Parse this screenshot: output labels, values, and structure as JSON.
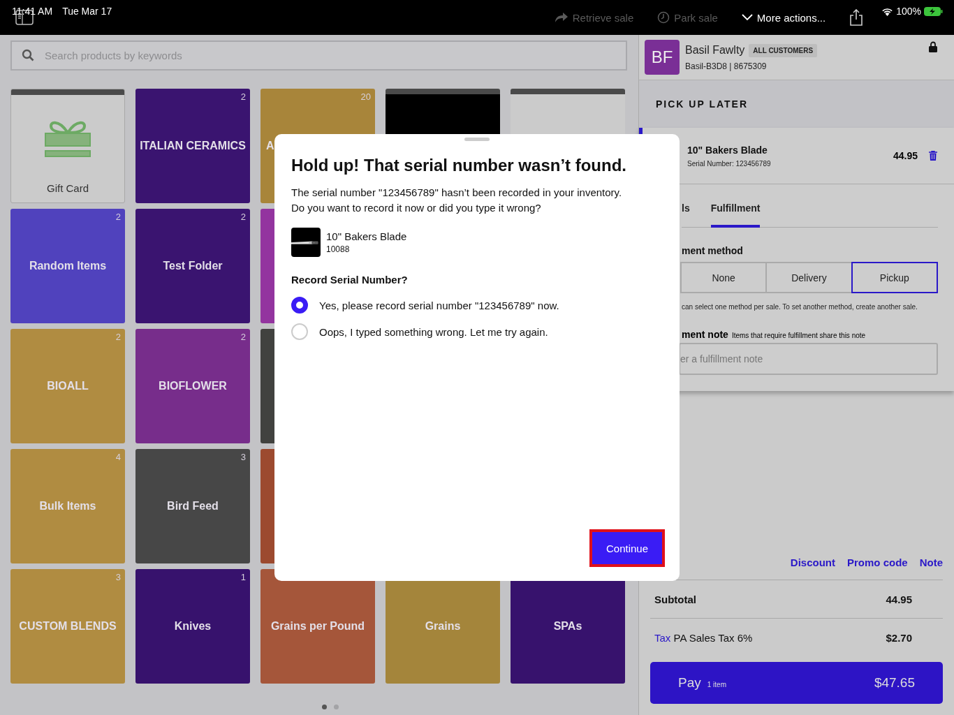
{
  "status_bar": {
    "time": "11:41 AM",
    "date": "Tue Mar 17",
    "battery": "100%"
  },
  "toolbar": [
    {
      "label": "Retrieve sale",
      "kind": "retrieve",
      "disabled": true
    },
    {
      "label": "Park sale",
      "kind": "park",
      "disabled": true
    },
    {
      "label": "More actions...",
      "kind": "more",
      "disabled": false
    }
  ],
  "search": {
    "placeholder": "Search products by keywords"
  },
  "tile_rows": [
    [
      {
        "kind": "gift",
        "label": "Gift Card"
      },
      {
        "kind": "folder",
        "label": "ITALIAN CERAMICS",
        "count": "2",
        "color": "#3a1470"
      },
      {
        "kind": "folder",
        "label": "A",
        "count": "20",
        "color": "#a8853a",
        "clipped": true
      },
      {
        "kind": "picture"
      },
      {
        "kind": "blank"
      }
    ],
    [
      {
        "kind": "folder",
        "label": "Random Items",
        "count": "2",
        "color": "#5042bd"
      },
      {
        "kind": "folder",
        "label": "Test Folder",
        "count": "2",
        "color": "#3a1470"
      },
      {
        "kind": "folder",
        "color": "#93349f"
      }
    ],
    [
      {
        "kind": "folder",
        "label": "BIOALL",
        "count": "2",
        "color": "#b08c41"
      },
      {
        "kind": "folder",
        "label": "BIOFLOWER",
        "count": "2",
        "color": "#772d8b"
      },
      {
        "kind": "folder",
        "color": "#41423f"
      }
    ],
    [
      {
        "kind": "folder",
        "label": "Bulk Items",
        "count": "4",
        "color": "#b08c41"
      },
      {
        "kind": "folder",
        "label": "Bird Feed",
        "count": "3",
        "color": "#474747"
      },
      {
        "kind": "folder",
        "color": "#9c4a2f"
      }
    ],
    [
      {
        "kind": "folder",
        "label": "CUSTOM BLENDS",
        "count": "3",
        "color": "#b08c41"
      },
      {
        "kind": "folder",
        "label": "Knives",
        "count": "1",
        "color": "#37126d"
      },
      {
        "kind": "folder",
        "label": "Grains per Pound",
        "color": "#a5563a"
      },
      {
        "kind": "folder",
        "label": "Grains",
        "color": "#a4853b"
      },
      {
        "kind": "folder",
        "label": "SPAs",
        "color": "#37126d"
      }
    ]
  ],
  "pages": [
    {
      "selected": true
    },
    {
      "selected": false
    }
  ],
  "customer": {
    "initials": "BF",
    "name": "Basil Fawlty",
    "badge": "ALL CUSTOMERS",
    "details": "Basil-B3D8 | 8675309"
  },
  "sale_type": "PICK UP LATER",
  "line_item": {
    "name": "10\" Bakers Blade",
    "serial": "Serial Number: 123456789",
    "price": "44.95"
  },
  "detail_tabs": [
    {
      "label": "ls",
      "selected": false
    },
    {
      "label": "Fulfillment",
      "selected": true
    }
  ],
  "fulfillment": {
    "method_label": "ment method",
    "methods": [
      {
        "label": "None",
        "selected": false
      },
      {
        "label": "Delivery",
        "selected": false
      },
      {
        "label": "Pickup",
        "selected": true
      }
    ],
    "hint": "can select one method per sale. To set another method, create another sale.",
    "note_label": "ment note",
    "note_hint": "Items that require fulfillment share this note",
    "note_placeholder": "er a fulfillment note"
  },
  "cart_links": [
    "Discount",
    "Promo code",
    "Note"
  ],
  "totals": [
    {
      "kind": "subtotal",
      "label": "Subtotal",
      "value": "44.95"
    },
    {
      "kind": "tax",
      "link": "Tax",
      "label": "PA Sales Tax 6%",
      "value": "$2.70"
    }
  ],
  "pay": {
    "label": "Pay",
    "count": "1 item",
    "amount": "$47.65"
  },
  "dialog": {
    "title": "Hold up! That serial number wasn’t found.",
    "message": [
      "The serial number \"123456789\" hasn’t been recorded in your inventory.",
      "Do you want to record it now or did you type it wrong?"
    ],
    "product": {
      "name": "10\" Bakers Blade",
      "sku": "10088"
    },
    "question": "Record Serial Number?",
    "options": [
      {
        "label": "Yes, please record serial number \"123456789\" now.",
        "selected": true
      },
      {
        "label": "Oops, I typed something wrong. Let me try again.",
        "selected": false
      }
    ],
    "button": {
      "label": "Continue",
      "focused": true
    }
  }
}
